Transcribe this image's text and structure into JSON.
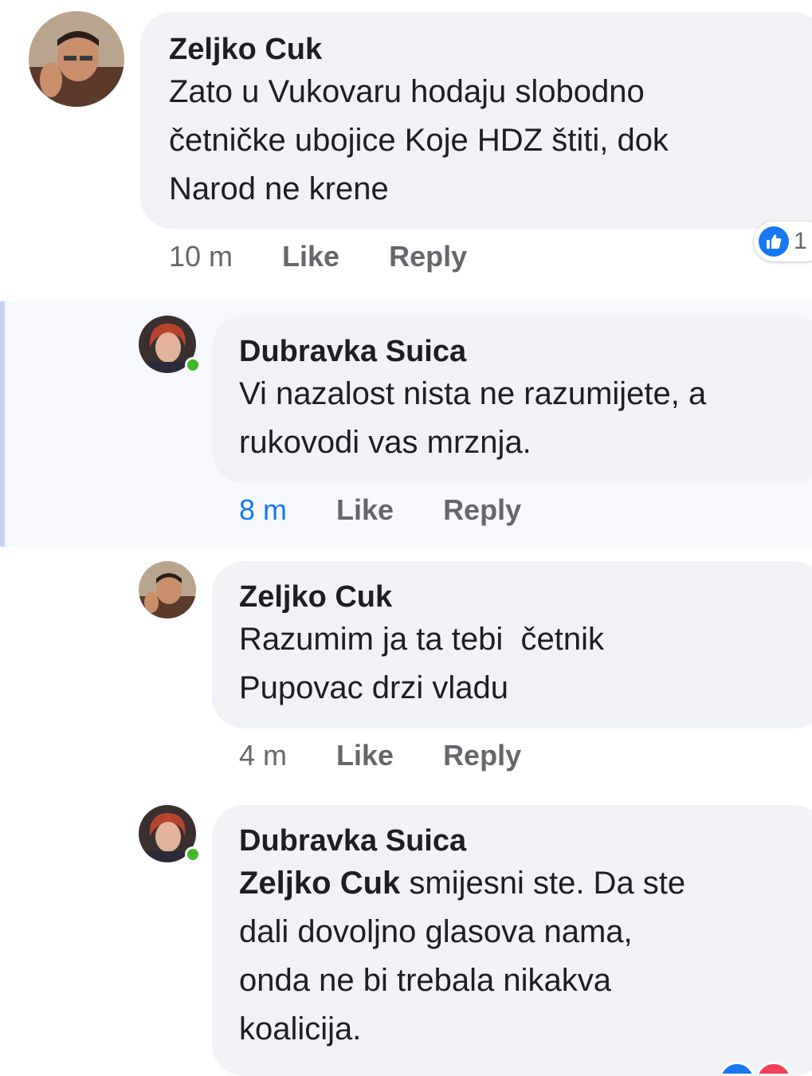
{
  "comments": [
    {
      "author": "Zeljko Cuk",
      "lines": [
        "Zato u Vukovaru hodaju slobodno",
        "četničke ubojice Koje HDZ štiti, dok",
        "Narod ne krene"
      ],
      "time": "10 m",
      "like_label": "Like",
      "reply_label": "Reply",
      "reaction_count": "1"
    },
    {
      "author": "Dubravka Suica",
      "lines": [
        "Vi nazalost nista ne razumijete, a",
        "rukovodi vas mrznja."
      ],
      "time": "8 m",
      "like_label": "Like",
      "reply_label": "Reply"
    },
    {
      "author": "Zeljko Cuk",
      "lines": [
        "Razumim ja ta tebi  četnik",
        "Pupovac drzi vladu"
      ],
      "time": "4 m",
      "like_label": "Like",
      "reply_label": "Reply"
    },
    {
      "author": "Dubravka Suica",
      "mention": "Zeljko Cuk",
      "lines": [
        " smijesni ste. Da ste",
        "dali dovoljno glasova nama,",
        "onda ne bi trebala nikakva",
        "koalicija."
      ]
    }
  ],
  "colors": {
    "bubble": "#f0f2f5",
    "unread_time": "#1877f2",
    "online": "#42b72a",
    "like_blue": "#1877f2"
  }
}
